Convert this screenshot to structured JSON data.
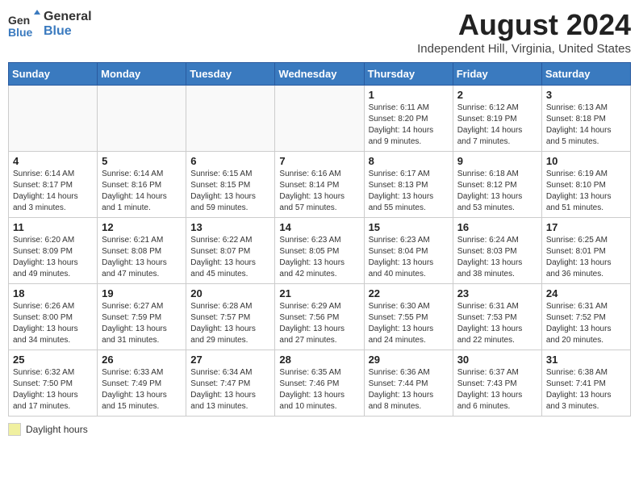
{
  "logo": {
    "general": "General",
    "blue": "Blue"
  },
  "title": "August 2024",
  "location": "Independent Hill, Virginia, United States",
  "days_of_week": [
    "Sunday",
    "Monday",
    "Tuesday",
    "Wednesday",
    "Thursday",
    "Friday",
    "Saturday"
  ],
  "legend_label": "Daylight hours",
  "weeks": [
    [
      {
        "day": "",
        "info": ""
      },
      {
        "day": "",
        "info": ""
      },
      {
        "day": "",
        "info": ""
      },
      {
        "day": "",
        "info": ""
      },
      {
        "day": "1",
        "info": "Sunrise: 6:11 AM\nSunset: 8:20 PM\nDaylight: 14 hours\nand 9 minutes."
      },
      {
        "day": "2",
        "info": "Sunrise: 6:12 AM\nSunset: 8:19 PM\nDaylight: 14 hours\nand 7 minutes."
      },
      {
        "day": "3",
        "info": "Sunrise: 6:13 AM\nSunset: 8:18 PM\nDaylight: 14 hours\nand 5 minutes."
      }
    ],
    [
      {
        "day": "4",
        "info": "Sunrise: 6:14 AM\nSunset: 8:17 PM\nDaylight: 14 hours\nand 3 minutes."
      },
      {
        "day": "5",
        "info": "Sunrise: 6:14 AM\nSunset: 8:16 PM\nDaylight: 14 hours\nand 1 minute."
      },
      {
        "day": "6",
        "info": "Sunrise: 6:15 AM\nSunset: 8:15 PM\nDaylight: 13 hours\nand 59 minutes."
      },
      {
        "day": "7",
        "info": "Sunrise: 6:16 AM\nSunset: 8:14 PM\nDaylight: 13 hours\nand 57 minutes."
      },
      {
        "day": "8",
        "info": "Sunrise: 6:17 AM\nSunset: 8:13 PM\nDaylight: 13 hours\nand 55 minutes."
      },
      {
        "day": "9",
        "info": "Sunrise: 6:18 AM\nSunset: 8:12 PM\nDaylight: 13 hours\nand 53 minutes."
      },
      {
        "day": "10",
        "info": "Sunrise: 6:19 AM\nSunset: 8:10 PM\nDaylight: 13 hours\nand 51 minutes."
      }
    ],
    [
      {
        "day": "11",
        "info": "Sunrise: 6:20 AM\nSunset: 8:09 PM\nDaylight: 13 hours\nand 49 minutes."
      },
      {
        "day": "12",
        "info": "Sunrise: 6:21 AM\nSunset: 8:08 PM\nDaylight: 13 hours\nand 47 minutes."
      },
      {
        "day": "13",
        "info": "Sunrise: 6:22 AM\nSunset: 8:07 PM\nDaylight: 13 hours\nand 45 minutes."
      },
      {
        "day": "14",
        "info": "Sunrise: 6:23 AM\nSunset: 8:05 PM\nDaylight: 13 hours\nand 42 minutes."
      },
      {
        "day": "15",
        "info": "Sunrise: 6:23 AM\nSunset: 8:04 PM\nDaylight: 13 hours\nand 40 minutes."
      },
      {
        "day": "16",
        "info": "Sunrise: 6:24 AM\nSunset: 8:03 PM\nDaylight: 13 hours\nand 38 minutes."
      },
      {
        "day": "17",
        "info": "Sunrise: 6:25 AM\nSunset: 8:01 PM\nDaylight: 13 hours\nand 36 minutes."
      }
    ],
    [
      {
        "day": "18",
        "info": "Sunrise: 6:26 AM\nSunset: 8:00 PM\nDaylight: 13 hours\nand 34 minutes."
      },
      {
        "day": "19",
        "info": "Sunrise: 6:27 AM\nSunset: 7:59 PM\nDaylight: 13 hours\nand 31 minutes."
      },
      {
        "day": "20",
        "info": "Sunrise: 6:28 AM\nSunset: 7:57 PM\nDaylight: 13 hours\nand 29 minutes."
      },
      {
        "day": "21",
        "info": "Sunrise: 6:29 AM\nSunset: 7:56 PM\nDaylight: 13 hours\nand 27 minutes."
      },
      {
        "day": "22",
        "info": "Sunrise: 6:30 AM\nSunset: 7:55 PM\nDaylight: 13 hours\nand 24 minutes."
      },
      {
        "day": "23",
        "info": "Sunrise: 6:31 AM\nSunset: 7:53 PM\nDaylight: 13 hours\nand 22 minutes."
      },
      {
        "day": "24",
        "info": "Sunrise: 6:31 AM\nSunset: 7:52 PM\nDaylight: 13 hours\nand 20 minutes."
      }
    ],
    [
      {
        "day": "25",
        "info": "Sunrise: 6:32 AM\nSunset: 7:50 PM\nDaylight: 13 hours\nand 17 minutes."
      },
      {
        "day": "26",
        "info": "Sunrise: 6:33 AM\nSunset: 7:49 PM\nDaylight: 13 hours\nand 15 minutes."
      },
      {
        "day": "27",
        "info": "Sunrise: 6:34 AM\nSunset: 7:47 PM\nDaylight: 13 hours\nand 13 minutes."
      },
      {
        "day": "28",
        "info": "Sunrise: 6:35 AM\nSunset: 7:46 PM\nDaylight: 13 hours\nand 10 minutes."
      },
      {
        "day": "29",
        "info": "Sunrise: 6:36 AM\nSunset: 7:44 PM\nDaylight: 13 hours\nand 8 minutes."
      },
      {
        "day": "30",
        "info": "Sunrise: 6:37 AM\nSunset: 7:43 PM\nDaylight: 13 hours\nand 6 minutes."
      },
      {
        "day": "31",
        "info": "Sunrise: 6:38 AM\nSunset: 7:41 PM\nDaylight: 13 hours\nand 3 minutes."
      }
    ]
  ]
}
